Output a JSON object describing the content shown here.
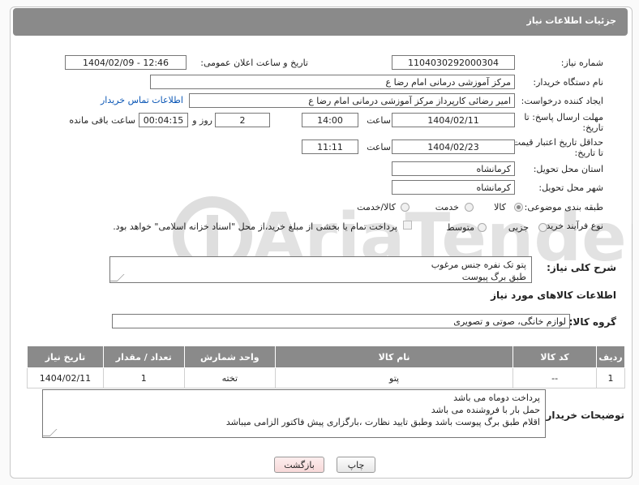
{
  "header": {
    "title": "جزئیات اطلاعات نیاز"
  },
  "fields": {
    "need_number_label": "شماره نیاز:",
    "need_number": "1104030292000304",
    "announce_label": "تاریخ و ساعت اعلان عمومی:",
    "announce_value": "1404/02/09 - 12:46",
    "buyer_org_label": "نام دستگاه خریدار:",
    "buyer_org": "مرکز آموزشی  درمانی امام رضا  ع",
    "creator_label": "ایجاد کننده درخواست:",
    "creator": "امیر رضائی کارپرداز مرکز آموزشی  درمانی امام رضا  ع",
    "contact_link": "اطلاعات تماس خریدار",
    "deadline_label_1": "مهلت ارسال پاسخ: تا",
    "deadline_label_2": "تاریخ:",
    "deadline_date": "1404/02/11",
    "time_label": "ساعت",
    "deadline_time": "14:00",
    "days_value": "2",
    "days_label": "روز و",
    "remaining_time": "00:04:15",
    "remaining_label": "ساعت باقی مانده",
    "price_label_1": "حداقل تاریخ اعتبار قیمت:",
    "price_label_2": "تا تاریخ:",
    "price_date": "1404/02/23",
    "price_time_label": "ساعت",
    "price_time": "11:11",
    "province_label": "استان محل تحویل:",
    "province": "کرمانشاه",
    "city_label": "شهر محل تحویل:",
    "city": "کرمانشاه",
    "category_label": "طبقه بندی موضوعی:",
    "category_options": [
      "کالا",
      "خدمت",
      "کالا/خدمت"
    ],
    "process_label": "نوع فرآیند خرید :",
    "process_options": [
      "جزیی",
      "متوسط"
    ],
    "payment_note": "پرداخت تمام یا بخشی از مبلغ خرید،از محل \"اسناد خزانه اسلامی\" خواهد بود."
  },
  "description": {
    "label": "شرح کلی نیاز:",
    "text": "پتو تک نفره جنس مرغوب\nطبق برگ پیوست"
  },
  "goods": {
    "section_title": "اطلاعات کالاهای مورد نیاز",
    "group_label": "گروه کالا:",
    "group_value": "لوازم خانگی، صوتی و تصویری",
    "columns": [
      "ردیف",
      "کد کالا",
      "نام کالا",
      "واحد شمارش",
      "تعداد / مقدار",
      "تاریخ نیاز"
    ],
    "rows": [
      [
        "1",
        "--",
        "پتو",
        "تخته",
        "1",
        "1404/02/11"
      ]
    ]
  },
  "buyer_notes": {
    "label": "توضیحات خریدار:",
    "text": "پرداخت دوماه می باشد\nحمل بار با فروشنده می باشد\nاقلام طبق برگ پیوست باشد وطبق تایید نظارت ،بارگزاری پیش فاکتور الزامی میباشد"
  },
  "buttons": {
    "print": "چاپ",
    "back": "بازگشت"
  },
  "watermark": {
    "text": "AriaTender.neT"
  },
  "colors": {
    "header_bg": "#8a8a8a",
    "link": "#0a56b5",
    "back_button_bg": "#fbe3e3"
  }
}
